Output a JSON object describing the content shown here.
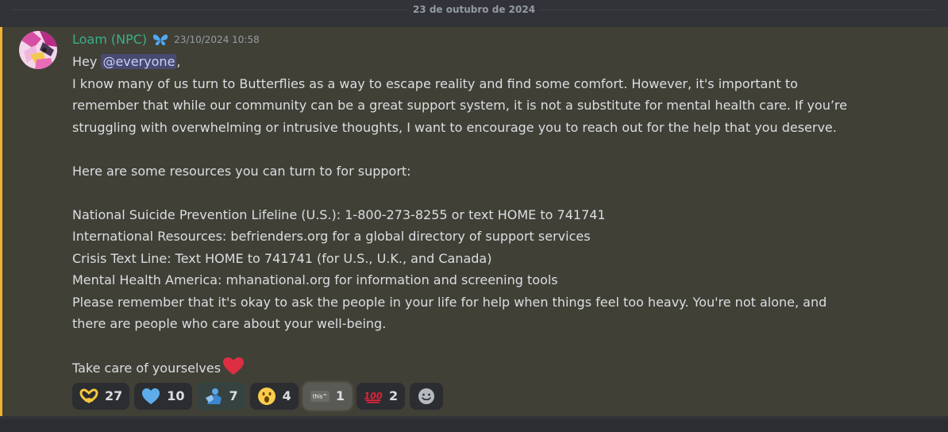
{
  "divider": {
    "date": "23 de outubro de 2024"
  },
  "message": {
    "username": "Loam (NPC)",
    "timestamp": "23/10/2024 10:58",
    "greeting_prefix": "Hey ",
    "mention": "@everyone",
    "greeting_suffix": ",",
    "lines": [
      "I know many of us turn to Butterflies as a way to escape reality and find some comfort. However, it's important to",
      "remember that while our community can be a great support system, it is not a substitute for mental health care. If you’re",
      "struggling with overwhelming or intrusive thoughts, I want to encourage you to reach out for the help that you deserve.",
      "",
      "Here are some resources you can turn to for support:",
      "",
      "National Suicide Prevention Lifeline (U.S.): 1-800-273-8255 or text HOME to 741741",
      "International Resources: befrienders.org for a global directory of support services",
      "Crisis Text Line: Text HOME to 741741 (for U.S., U.K., and Canada)",
      "Mental Health America: mhanational.org for information and screening tools",
      "Please remember that it's okay to ask the people in your life for help when things feel too heavy. You're not alone, and",
      "there are people who care about your well-being.",
      "",
      "Take care of yourselves"
    ],
    "accent_color": "#f0b232",
    "username_color": "#3aaf87"
  },
  "reactions": [
    {
      "icon": "heart-hands-icon",
      "count": "27"
    },
    {
      "icon": "blue-heart-icon",
      "count": "10"
    },
    {
      "icon": "hug-emoji-icon",
      "count": "7"
    },
    {
      "icon": "surprised-face-icon",
      "count": "4"
    },
    {
      "icon": "this-sticker-icon",
      "label": "this^",
      "count": "1"
    },
    {
      "icon": "hundred-points-icon",
      "label": "100",
      "count": "2"
    }
  ]
}
